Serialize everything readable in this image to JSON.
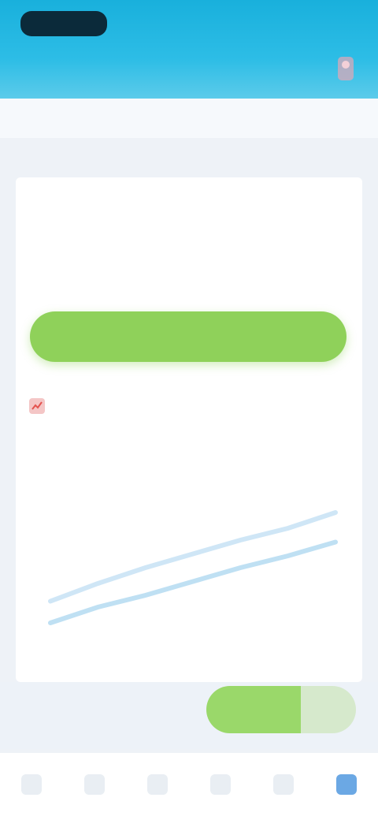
{
  "header": {
    "logo": "",
    "right_link": "",
    "subtitle": "",
    "mid_text": "",
    "icons": {
      "user": "user-icon"
    },
    "colors": {
      "bar": "#19b0dc"
    }
  },
  "ticker": {
    "items": []
  },
  "section": {
    "title": "",
    "subtitle": ""
  },
  "counters": [
    {
      "label": "",
      "value": "",
      "unit": "",
      "hot": true
    },
    {
      "label": "",
      "value": "",
      "unit": "",
      "hot": false
    },
    {
      "label": "",
      "value": "",
      "unit": "",
      "hot": false
    }
  ],
  "buy_button": {
    "label": "",
    "color": "#8fd15a"
  },
  "trend": {
    "icon": "chart-icon",
    "title": "",
    "more": ""
  },
  "chart_data": {
    "type": "line",
    "title": "",
    "xlabel": "",
    "ylabel": "",
    "x": [
      0,
      1,
      2,
      3,
      4,
      5,
      6
    ],
    "series": [
      {
        "values": [
          21,
          30,
          38,
          45,
          52,
          58,
          66
        ],
        "color": "#cfe6f6"
      },
      {
        "values": [
          10,
          18,
          24,
          31,
          38,
          44,
          51
        ],
        "color": "#bfe0f3"
      }
    ],
    "xlim": [
      0,
      6
    ],
    "ylim": [
      0,
      100
    ],
    "grid": false
  },
  "ask_button": {
    "label": "",
    "side_label": "",
    "color": "#9ad86a"
  },
  "nav": [
    {
      "label": "",
      "icon": "home-icon",
      "active": false
    },
    {
      "label": "",
      "icon": "list-icon",
      "active": false
    },
    {
      "label": "",
      "icon": "ticket-icon",
      "active": false
    },
    {
      "label": "",
      "icon": "wallet-icon",
      "active": false
    },
    {
      "label": "",
      "icon": "message-icon",
      "active": false
    },
    {
      "label": "",
      "icon": "profile-icon",
      "active": true
    }
  ]
}
